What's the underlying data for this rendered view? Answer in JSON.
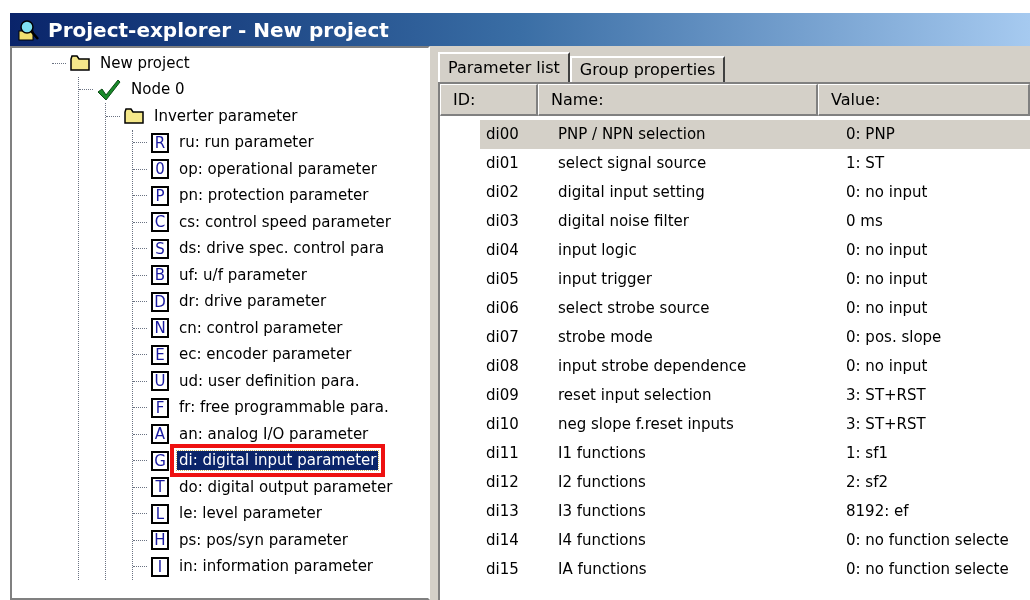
{
  "window": {
    "title": "Project-explorer - New project"
  },
  "tree": [
    {
      "kind": "folder",
      "label": "New project",
      "selected": false,
      "children": [
        {
          "kind": "node",
          "label": "Node 0",
          "selected": false,
          "children": [
            {
              "kind": "folder",
              "label": "Inverter parameter",
              "selected": false,
              "children": [
                {
                  "kind": "group",
                  "icon_letter": "R",
                  "label": "ru: run parameter",
                  "selected": false
                },
                {
                  "kind": "group",
                  "icon_letter": "0",
                  "label": "op: operational parameter",
                  "selected": false
                },
                {
                  "kind": "group",
                  "icon_letter": "P",
                  "label": "pn: protection parameter",
                  "selected": false
                },
                {
                  "kind": "group",
                  "icon_letter": "C",
                  "label": "cs: control speed parameter",
                  "selected": false
                },
                {
                  "kind": "group",
                  "icon_letter": "S",
                  "label": "ds: drive spec. control para",
                  "selected": false
                },
                {
                  "kind": "group",
                  "icon_letter": "B",
                  "label": "uf: u/f parameter",
                  "selected": false
                },
                {
                  "kind": "group",
                  "icon_letter": "D",
                  "label": "dr: drive parameter",
                  "selected": false
                },
                {
                  "kind": "group",
                  "icon_letter": "N",
                  "label": "cn: control parameter",
                  "selected": false
                },
                {
                  "kind": "group",
                  "icon_letter": "E",
                  "label": "ec: encoder parameter",
                  "selected": false
                },
                {
                  "kind": "group",
                  "icon_letter": "U",
                  "label": "ud: user definition para.",
                  "selected": false
                },
                {
                  "kind": "group",
                  "icon_letter": "F",
                  "label": "fr: free programmable para.",
                  "selected": false
                },
                {
                  "kind": "group",
                  "icon_letter": "A",
                  "label": "an: analog I/O parameter",
                  "selected": false
                },
                {
                  "kind": "group",
                  "icon_letter": "G",
                  "label": "di: digital input parameter",
                  "selected": true
                },
                {
                  "kind": "group",
                  "icon_letter": "T",
                  "label": "do: digital output parameter",
                  "selected": false
                },
                {
                  "kind": "group",
                  "icon_letter": "L",
                  "label": "le: level parameter",
                  "selected": false
                },
                {
                  "kind": "group",
                  "icon_letter": "H",
                  "label": "ps: pos/syn parameter",
                  "selected": false
                },
                {
                  "kind": "group",
                  "icon_letter": "I",
                  "label": "in: information parameter",
                  "selected": false
                }
              ]
            }
          ]
        }
      ]
    }
  ],
  "tabs": [
    {
      "label": "Parameter list",
      "selected": true
    },
    {
      "label": "Group properties",
      "selected": false
    }
  ],
  "table": {
    "columns": [
      "ID:",
      "Name:",
      "Value:"
    ],
    "rows": [
      {
        "id": "di00",
        "name": "PNP / NPN selection",
        "value": "0: PNP",
        "selected": true
      },
      {
        "id": "di01",
        "name": "select signal source",
        "value": "1: ST",
        "selected": false
      },
      {
        "id": "di02",
        "name": "digital input setting",
        "value": "0: no input",
        "selected": false
      },
      {
        "id": "di03",
        "name": "digital noise filter",
        "value": "0 ms",
        "selected": false
      },
      {
        "id": "di04",
        "name": "input logic",
        "value": "0: no input",
        "selected": false
      },
      {
        "id": "di05",
        "name": "input trigger",
        "value": "0: no input",
        "selected": false
      },
      {
        "id": "di06",
        "name": "select strobe source",
        "value": "0: no input",
        "selected": false
      },
      {
        "id": "di07",
        "name": "strobe mode",
        "value": "0: pos. slope",
        "selected": false
      },
      {
        "id": "di08",
        "name": "input strobe dependence",
        "value": "0: no input",
        "selected": false
      },
      {
        "id": "di09",
        "name": "reset input selection",
        "value": "3: ST+RST",
        "selected": false
      },
      {
        "id": "di10",
        "name": "neg slope f.reset inputs",
        "value": "3: ST+RST",
        "selected": false
      },
      {
        "id": "di11",
        "name": "I1 functions",
        "value": "1: sf1",
        "selected": false
      },
      {
        "id": "di12",
        "name": "I2 functions",
        "value": "2: sf2",
        "selected": false
      },
      {
        "id": "di13",
        "name": "I3 functions",
        "value": "8192: ef",
        "selected": false
      },
      {
        "id": "di14",
        "name": "I4 functions",
        "value": "0: no function selecte",
        "selected": false
      },
      {
        "id": "di15",
        "name": "IA functions",
        "value": "0: no function selecte",
        "selected": false
      }
    ]
  }
}
